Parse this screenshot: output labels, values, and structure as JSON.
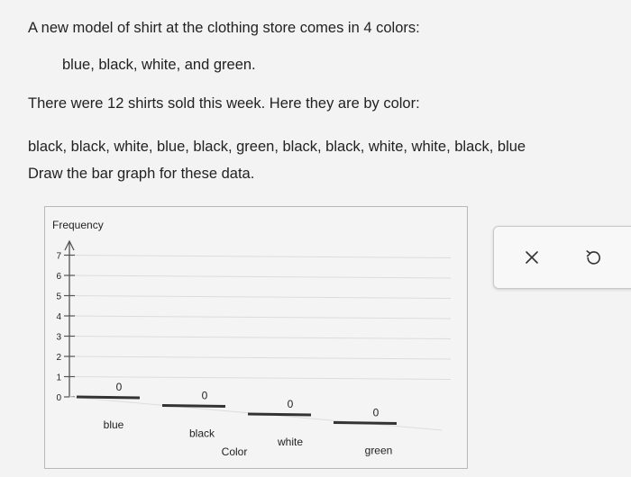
{
  "problem": {
    "line1": "A new model of shirt at the clothing store comes in 4 colors:",
    "line2": "blue, black, white, and green.",
    "line3": "There were 12 shirts sold this week. Here they are by color:",
    "line4": "black, black, white, blue, black, green, black, black, white, white, black, blue",
    "line5": "Draw the bar graph for these data."
  },
  "chart_data": {
    "type": "bar",
    "ylabel": "Frequency",
    "xlabel": "Color",
    "categories": [
      "blue",
      "black",
      "white",
      "green"
    ],
    "values": [
      0,
      0,
      0,
      0
    ],
    "value_labels": [
      "0",
      "0",
      "0",
      "0"
    ],
    "yticks": [
      "0",
      "1",
      "2",
      "3",
      "4",
      "5",
      "6",
      "7"
    ],
    "ylim": [
      0,
      7
    ],
    "grid": true
  },
  "toolbar": {
    "close_icon": "close-icon",
    "undo_icon": "undo-icon"
  }
}
